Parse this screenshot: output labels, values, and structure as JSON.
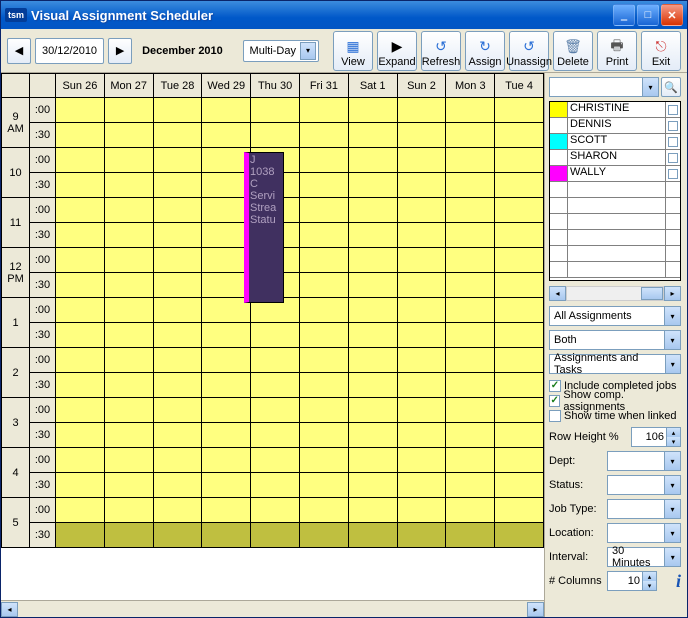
{
  "title": "Visual Assignment Scheduler",
  "toolbar": {
    "date": "30/12/2010",
    "month_label": "December 2010",
    "view_mode": "Multi-Day",
    "buttons": {
      "view": "View",
      "expand": "Expand",
      "refresh": "Refresh",
      "assign": "Assign",
      "unassign": "Unassign",
      "delete": "Delete",
      "print": "Print",
      "exit": "Exit"
    }
  },
  "days": [
    "Sun 26",
    "Mon 27",
    "Tue 28",
    "Wed 29",
    "Thu 30",
    "Fri 31",
    "Sat 1",
    "Sun 2",
    "Mon 3",
    "Tue 4"
  ],
  "hours": [
    {
      "h": "9",
      "p": "AM"
    },
    {
      "h": "10",
      "p": ""
    },
    {
      "h": "11",
      "p": ""
    },
    {
      "h": "12",
      "p": "PM"
    },
    {
      "h": "1",
      "p": ""
    },
    {
      "h": "2",
      "p": ""
    },
    {
      "h": "3",
      "p": ""
    },
    {
      "h": "4",
      "p": ""
    },
    {
      "h": "5",
      "p": ""
    }
  ],
  "minutes": [
    ":00",
    ":30"
  ],
  "appointment": {
    "lines": [
      "J",
      "1038",
      "C",
      "Servi",
      "Strea",
      "",
      "Statu"
    ]
  },
  "employees": [
    {
      "name": "CHRISTINE",
      "color": "#ffff00"
    },
    {
      "name": "DENNIS",
      "color": "#ffffff"
    },
    {
      "name": "SCOTT",
      "color": "#00ffff"
    },
    {
      "name": "SHARON",
      "color": "#ffffff"
    },
    {
      "name": "WALLY",
      "color": "#ff00ff"
    }
  ],
  "filters": {
    "assignments": "All Assignments",
    "both": "Both",
    "at": "Assignments and Tasks"
  },
  "checks": {
    "include_completed": {
      "label": "Include completed jobs",
      "checked": true
    },
    "show_comp": {
      "label": "Show comp. assignments",
      "checked": true
    },
    "show_time": {
      "label": "Show time when linked",
      "checked": false
    }
  },
  "fields": {
    "row_height_label": "Row Height %",
    "row_height": "106",
    "dept": "Dept:",
    "status": "Status:",
    "jobtype": "Job Type:",
    "location": "Location:",
    "interval_label": "Interval:",
    "interval": "30 Minutes",
    "cols_label": "# Columns",
    "cols": "10"
  }
}
